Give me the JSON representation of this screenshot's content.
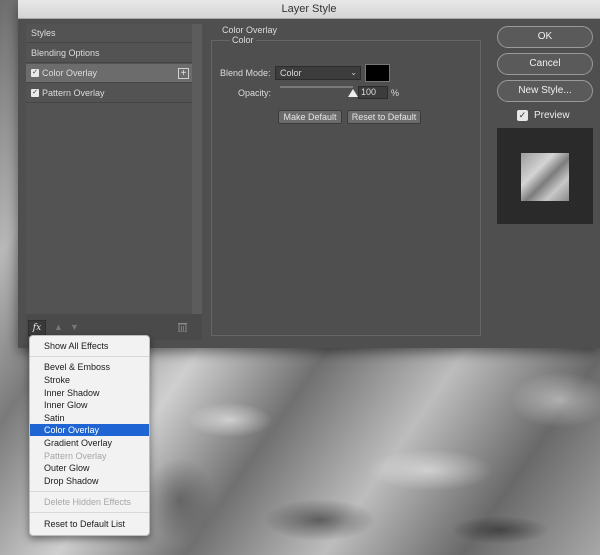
{
  "dialog": {
    "title": "Layer Style"
  },
  "left_panel": {
    "items": [
      {
        "label": "Styles",
        "checked": false
      },
      {
        "label": "Blending Options",
        "checked": false
      },
      {
        "label": "Color Overlay",
        "checked": true,
        "selected": true
      },
      {
        "label": "Pattern Overlay",
        "checked": true
      }
    ],
    "add_icon": "+",
    "fx_label": "fx"
  },
  "center": {
    "section_title": "Color Overlay",
    "group_label": "Color",
    "blend_mode_label": "Blend Mode:",
    "blend_mode_value": "Color",
    "overlay_color": "#000000",
    "opacity_label": "Opacity:",
    "opacity_value": "100",
    "opacity_unit": "%",
    "opacity_fraction": 1.0,
    "make_default_label": "Make Default",
    "reset_default_label": "Reset to Default"
  },
  "right": {
    "ok_label": "OK",
    "cancel_label": "Cancel",
    "new_style_label": "New Style...",
    "preview_label": "Preview",
    "preview_checked": true
  },
  "fx_menu": {
    "items": [
      {
        "label": "Show All Effects"
      },
      {
        "label": "Bevel & Emboss"
      },
      {
        "label": "Stroke"
      },
      {
        "label": "Inner Shadow"
      },
      {
        "label": "Inner Glow"
      },
      {
        "label": "Satin"
      },
      {
        "label": "Color Overlay",
        "highlighted": true
      },
      {
        "label": "Gradient Overlay"
      },
      {
        "label": "Pattern Overlay",
        "disabled": true
      },
      {
        "label": "Outer Glow"
      },
      {
        "label": "Drop Shadow"
      },
      {
        "label": "Delete Hidden Effects",
        "disabled": true
      },
      {
        "label": "Reset to Default List"
      }
    ]
  },
  "colors": {
    "highlight": "#1e64d2",
    "dialog_bg": "#4f4f4f"
  }
}
